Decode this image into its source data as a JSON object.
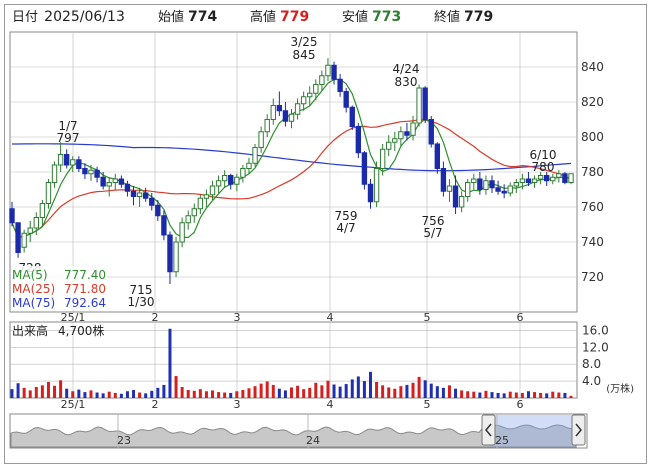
{
  "header": {
    "date_label": "日付",
    "date": "2025/06/13",
    "open_label": "始値",
    "open": "774",
    "high_label": "高値",
    "high": "779",
    "low_label": "安値",
    "low": "773",
    "close_label": "終値",
    "close": "779"
  },
  "colors": {
    "up": "#2f7d32",
    "down": "#1a2aa8",
    "ma5": "#2f8f2f",
    "ma25": "#d93a2a",
    "ma75": "#2a3bd0",
    "volume_up": "#d62020",
    "volume_down": "#2030b0",
    "grid": "#b9b9b9"
  },
  "legend": [
    {
      "label": "MA(5)",
      "value": "777.40",
      "color": "#2f8f2f"
    },
    {
      "label": "MA(25)",
      "value": "771.80",
      "color": "#d93a2a"
    },
    {
      "label": "MA(75)",
      "value": "792.64",
      "color": "#2a3bd0"
    }
  ],
  "price_axis": {
    "ticks": [
      "840",
      "820",
      "800",
      "780",
      "760",
      "740",
      "720"
    ]
  },
  "month_ticks": [
    "25/1",
    "2",
    "3",
    "4",
    "5",
    "6"
  ],
  "annotations": [
    {
      "date": "1/7",
      "value": "797"
    },
    {
      "date": "3/25",
      "value": "845"
    },
    {
      "date": "4/24",
      "value": "830"
    },
    {
      "date": "6/10",
      "value": "780"
    },
    {
      "date": "4/7",
      "value": "759"
    },
    {
      "date": "5/7",
      "value": "756"
    },
    {
      "date": "1/30",
      "value": "715"
    },
    {
      "value": "728"
    }
  ],
  "volume": {
    "label": "出来高",
    "value": "4,700株",
    "unit": "(万株)",
    "ticks": [
      "16.0",
      "12.0",
      "8.0",
      "4.0"
    ]
  },
  "navigator": {
    "years": [
      "23",
      "24",
      "25"
    ],
    "left_handle_icon": "chevron-left-icon",
    "right_handle_icon": "chevron-right-icon"
  },
  "chart_data": [
    {
      "type": "candlestick",
      "title": "",
      "x_axis_ticks": [
        "25/1",
        "2",
        "3",
        "4",
        "5",
        "6"
      ],
      "ylim": [
        700,
        860
      ],
      "y_ticks": [
        720,
        740,
        760,
        780,
        800,
        820,
        840
      ],
      "grid": true,
      "last_candle": {
        "date": "2025/06/13",
        "open": 774,
        "high": 779,
        "low": 773,
        "close": 779
      },
      "ohlc": [
        [
          759,
          763,
          749,
          751
        ],
        [
          751,
          751,
          731,
          734
        ],
        [
          737,
          747,
          734,
          745
        ],
        [
          745,
          752,
          740,
          748
        ],
        [
          748,
          757,
          744,
          754
        ],
        [
          754,
          764,
          749,
          762
        ],
        [
          762,
          776,
          759,
          774
        ],
        [
          774,
          786,
          771,
          784
        ],
        [
          784,
          797,
          780,
          790
        ],
        [
          790,
          793,
          782,
          784
        ],
        [
          784,
          789,
          780,
          787
        ],
        [
          787,
          789,
          780,
          782
        ],
        [
          782,
          785,
          776,
          779
        ],
        [
          779,
          784,
          775,
          781
        ],
        [
          781,
          783,
          774,
          777
        ],
        [
          777,
          780,
          770,
          772
        ],
        [
          772,
          777,
          766,
          774
        ],
        [
          774,
          779,
          770,
          776
        ],
        [
          776,
          778,
          771,
          773
        ],
        [
          773,
          775,
          766,
          769
        ],
        [
          769,
          772,
          761,
          766
        ],
        [
          766,
          771,
          760,
          768
        ],
        [
          768,
          771,
          763,
          765
        ],
        [
          765,
          768,
          758,
          761
        ],
        [
          761,
          764,
          752,
          755
        ],
        [
          755,
          758,
          741,
          744
        ],
        [
          744,
          746,
          716,
          723
        ],
        [
          723,
          743,
          720,
          740
        ],
        [
          740,
          754,
          737,
          751
        ],
        [
          751,
          758,
          747,
          755
        ],
        [
          755,
          762,
          751,
          759
        ],
        [
          759,
          767,
          756,
          765
        ],
        [
          765,
          770,
          760,
          767
        ],
        [
          767,
          775,
          764,
          772
        ],
        [
          772,
          778,
          768,
          775
        ],
        [
          775,
          781,
          771,
          778
        ],
        [
          778,
          779,
          770,
          773
        ],
        [
          773,
          779,
          769,
          777
        ],
        [
          777,
          784,
          774,
          782
        ],
        [
          782,
          788,
          779,
          785
        ],
        [
          785,
          796,
          783,
          794
        ],
        [
          794,
          806,
          791,
          803
        ],
        [
          803,
          813,
          800,
          810
        ],
        [
          810,
          822,
          807,
          818
        ],
        [
          818,
          826,
          812,
          815
        ],
        [
          815,
          820,
          806,
          809
        ],
        [
          809,
          816,
          805,
          813
        ],
        [
          813,
          822,
          810,
          819
        ],
        [
          819,
          826,
          815,
          823
        ],
        [
          823,
          829,
          818,
          825
        ],
        [
          825,
          833,
          821,
          830
        ],
        [
          830,
          838,
          826,
          835
        ],
        [
          835,
          845,
          832,
          841
        ],
        [
          841,
          843,
          830,
          833
        ],
        [
          833,
          836,
          823,
          826
        ],
        [
          826,
          828,
          814,
          817
        ],
        [
          817,
          818,
          804,
          806
        ],
        [
          806,
          808,
          788,
          791
        ],
        [
          791,
          792,
          770,
          773
        ],
        [
          773,
          776,
          759,
          763
        ],
        [
          763,
          786,
          760,
          782
        ],
        [
          782,
          796,
          778,
          793
        ],
        [
          793,
          801,
          789,
          797
        ],
        [
          797,
          803,
          792,
          799
        ],
        [
          799,
          806,
          795,
          803
        ],
        [
          803,
          808,
          798,
          801
        ],
        [
          801,
          812,
          798,
          808
        ],
        [
          808,
          830,
          806,
          828
        ],
        [
          828,
          829,
          808,
          810
        ],
        [
          810,
          812,
          794,
          796
        ],
        [
          796,
          797,
          779,
          782
        ],
        [
          782,
          786,
          766,
          769
        ],
        [
          769,
          776,
          763,
          772
        ],
        [
          772,
          778,
          756,
          760
        ],
        [
          760,
          769,
          757,
          766
        ],
        [
          766,
          776,
          763,
          774
        ],
        [
          774,
          779,
          770,
          776
        ],
        [
          776,
          780,
          767,
          770
        ],
        [
          770,
          778,
          767,
          775
        ],
        [
          775,
          778,
          768,
          771
        ],
        [
          771,
          775,
          767,
          769
        ],
        [
          769,
          773,
          765,
          768
        ],
        [
          768,
          774,
          766,
          772
        ],
        [
          772,
          776,
          768,
          774
        ],
        [
          774,
          779,
          770,
          776
        ],
        [
          776,
          780,
          772,
          774
        ],
        [
          774,
          778,
          771,
          776
        ],
        [
          776,
          780,
          773,
          778
        ],
        [
          778,
          780,
          772,
          775
        ],
        [
          775,
          779,
          773,
          777
        ],
        [
          777,
          781,
          774,
          779
        ],
        [
          779,
          780,
          773,
          774
        ],
        [
          774,
          779,
          773,
          779
        ]
      ]
    },
    {
      "type": "bar",
      "title": "",
      "series_name": "出来高",
      "unit": "万株",
      "ylim": [
        0,
        18
      ],
      "y_ticks": [
        4,
        8,
        12,
        16
      ],
      "values": [
        2.1,
        3.5,
        2.4,
        1.8,
        2.6,
        3.0,
        3.8,
        2.9,
        4.2,
        2.2,
        1.6,
        2.0,
        1.4,
        1.8,
        1.3,
        1.1,
        1.5,
        1.2,
        1.0,
        1.6,
        1.9,
        1.3,
        1.1,
        1.7,
        2.4,
        3.1,
        16.4,
        5.2,
        2.6,
        1.9,
        1.7,
        2.1,
        1.6,
        1.8,
        1.4,
        1.3,
        1.2,
        1.6,
        1.9,
        2.3,
        2.8,
        3.4,
        3.9,
        3.1,
        2.2,
        1.8,
        2.5,
        2.9,
        2.1,
        2.4,
        3.6,
        3.0,
        4.1,
        3.2,
        2.7,
        3.3,
        4.4,
        5.1,
        4.0,
        6.2,
        3.8,
        3.0,
        2.5,
        2.2,
        2.8,
        3.1,
        3.6,
        5.0,
        4.2,
        3.4,
        2.8,
        2.4,
        3.0,
        2.2,
        1.8,
        1.6,
        1.5,
        1.3,
        1.7,
        1.4,
        1.2,
        1.1,
        1.5,
        1.3,
        1.2,
        1.6,
        1.4,
        1.2,
        1.1,
        1.5,
        1.3,
        1.2,
        0.5
      ]
    }
  ]
}
